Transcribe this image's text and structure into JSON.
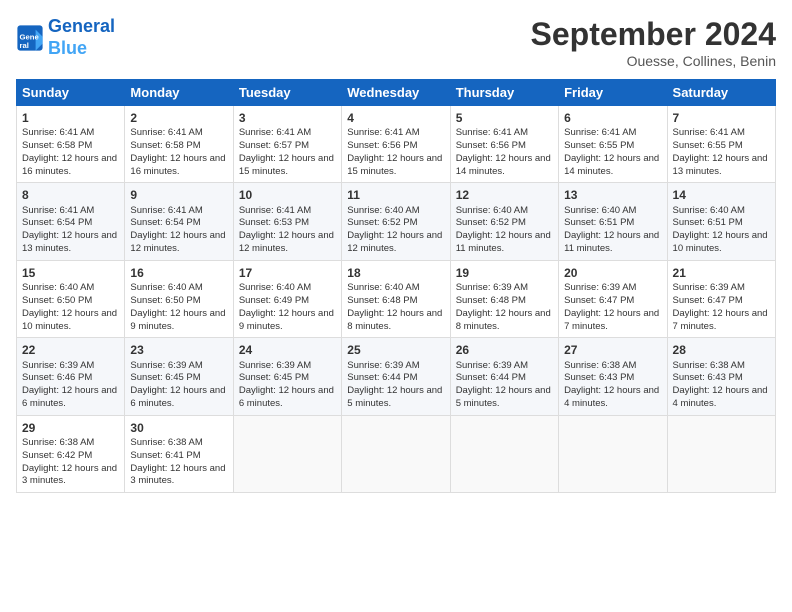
{
  "header": {
    "logo_line1": "General",
    "logo_line2": "Blue",
    "month": "September 2024",
    "location": "Ouesse, Collines, Benin"
  },
  "weekdays": [
    "Sunday",
    "Monday",
    "Tuesday",
    "Wednesday",
    "Thursday",
    "Friday",
    "Saturday"
  ],
  "weeks": [
    [
      {
        "day": "1",
        "sun": "Sunrise: 6:41 AM",
        "set": "Sunset: 6:58 PM",
        "day_text": "Daylight: 12 hours and 16 minutes."
      },
      {
        "day": "2",
        "sun": "Sunrise: 6:41 AM",
        "set": "Sunset: 6:58 PM",
        "day_text": "Daylight: 12 hours and 16 minutes."
      },
      {
        "day": "3",
        "sun": "Sunrise: 6:41 AM",
        "set": "Sunset: 6:57 PM",
        "day_text": "Daylight: 12 hours and 15 minutes."
      },
      {
        "day": "4",
        "sun": "Sunrise: 6:41 AM",
        "set": "Sunset: 6:56 PM",
        "day_text": "Daylight: 12 hours and 15 minutes."
      },
      {
        "day": "5",
        "sun": "Sunrise: 6:41 AM",
        "set": "Sunset: 6:56 PM",
        "day_text": "Daylight: 12 hours and 14 minutes."
      },
      {
        "day": "6",
        "sun": "Sunrise: 6:41 AM",
        "set": "Sunset: 6:55 PM",
        "day_text": "Daylight: 12 hours and 14 minutes."
      },
      {
        "day": "7",
        "sun": "Sunrise: 6:41 AM",
        "set": "Sunset: 6:55 PM",
        "day_text": "Daylight: 12 hours and 13 minutes."
      }
    ],
    [
      {
        "day": "8",
        "sun": "Sunrise: 6:41 AM",
        "set": "Sunset: 6:54 PM",
        "day_text": "Daylight: 12 hours and 13 minutes."
      },
      {
        "day": "9",
        "sun": "Sunrise: 6:41 AM",
        "set": "Sunset: 6:54 PM",
        "day_text": "Daylight: 12 hours and 12 minutes."
      },
      {
        "day": "10",
        "sun": "Sunrise: 6:41 AM",
        "set": "Sunset: 6:53 PM",
        "day_text": "Daylight: 12 hours and 12 minutes."
      },
      {
        "day": "11",
        "sun": "Sunrise: 6:40 AM",
        "set": "Sunset: 6:52 PM",
        "day_text": "Daylight: 12 hours and 12 minutes."
      },
      {
        "day": "12",
        "sun": "Sunrise: 6:40 AM",
        "set": "Sunset: 6:52 PM",
        "day_text": "Daylight: 12 hours and 11 minutes."
      },
      {
        "day": "13",
        "sun": "Sunrise: 6:40 AM",
        "set": "Sunset: 6:51 PM",
        "day_text": "Daylight: 12 hours and 11 minutes."
      },
      {
        "day": "14",
        "sun": "Sunrise: 6:40 AM",
        "set": "Sunset: 6:51 PM",
        "day_text": "Daylight: 12 hours and 10 minutes."
      }
    ],
    [
      {
        "day": "15",
        "sun": "Sunrise: 6:40 AM",
        "set": "Sunset: 6:50 PM",
        "day_text": "Daylight: 12 hours and 10 minutes."
      },
      {
        "day": "16",
        "sun": "Sunrise: 6:40 AM",
        "set": "Sunset: 6:50 PM",
        "day_text": "Daylight: 12 hours and 9 minutes."
      },
      {
        "day": "17",
        "sun": "Sunrise: 6:40 AM",
        "set": "Sunset: 6:49 PM",
        "day_text": "Daylight: 12 hours and 9 minutes."
      },
      {
        "day": "18",
        "sun": "Sunrise: 6:40 AM",
        "set": "Sunset: 6:48 PM",
        "day_text": "Daylight: 12 hours and 8 minutes."
      },
      {
        "day": "19",
        "sun": "Sunrise: 6:39 AM",
        "set": "Sunset: 6:48 PM",
        "day_text": "Daylight: 12 hours and 8 minutes."
      },
      {
        "day": "20",
        "sun": "Sunrise: 6:39 AM",
        "set": "Sunset: 6:47 PM",
        "day_text": "Daylight: 12 hours and 7 minutes."
      },
      {
        "day": "21",
        "sun": "Sunrise: 6:39 AM",
        "set": "Sunset: 6:47 PM",
        "day_text": "Daylight: 12 hours and 7 minutes."
      }
    ],
    [
      {
        "day": "22",
        "sun": "Sunrise: 6:39 AM",
        "set": "Sunset: 6:46 PM",
        "day_text": "Daylight: 12 hours and 6 minutes."
      },
      {
        "day": "23",
        "sun": "Sunrise: 6:39 AM",
        "set": "Sunset: 6:45 PM",
        "day_text": "Daylight: 12 hours and 6 minutes."
      },
      {
        "day": "24",
        "sun": "Sunrise: 6:39 AM",
        "set": "Sunset: 6:45 PM",
        "day_text": "Daylight: 12 hours and 6 minutes."
      },
      {
        "day": "25",
        "sun": "Sunrise: 6:39 AM",
        "set": "Sunset: 6:44 PM",
        "day_text": "Daylight: 12 hours and 5 minutes."
      },
      {
        "day": "26",
        "sun": "Sunrise: 6:39 AM",
        "set": "Sunset: 6:44 PM",
        "day_text": "Daylight: 12 hours and 5 minutes."
      },
      {
        "day": "27",
        "sun": "Sunrise: 6:38 AM",
        "set": "Sunset: 6:43 PM",
        "day_text": "Daylight: 12 hours and 4 minutes."
      },
      {
        "day": "28",
        "sun": "Sunrise: 6:38 AM",
        "set": "Sunset: 6:43 PM",
        "day_text": "Daylight: 12 hours and 4 minutes."
      }
    ],
    [
      {
        "day": "29",
        "sun": "Sunrise: 6:38 AM",
        "set": "Sunset: 6:42 PM",
        "day_text": "Daylight: 12 hours and 3 minutes."
      },
      {
        "day": "30",
        "sun": "Sunrise: 6:38 AM",
        "set": "Sunset: 6:41 PM",
        "day_text": "Daylight: 12 hours and 3 minutes."
      },
      null,
      null,
      null,
      null,
      null
    ]
  ]
}
